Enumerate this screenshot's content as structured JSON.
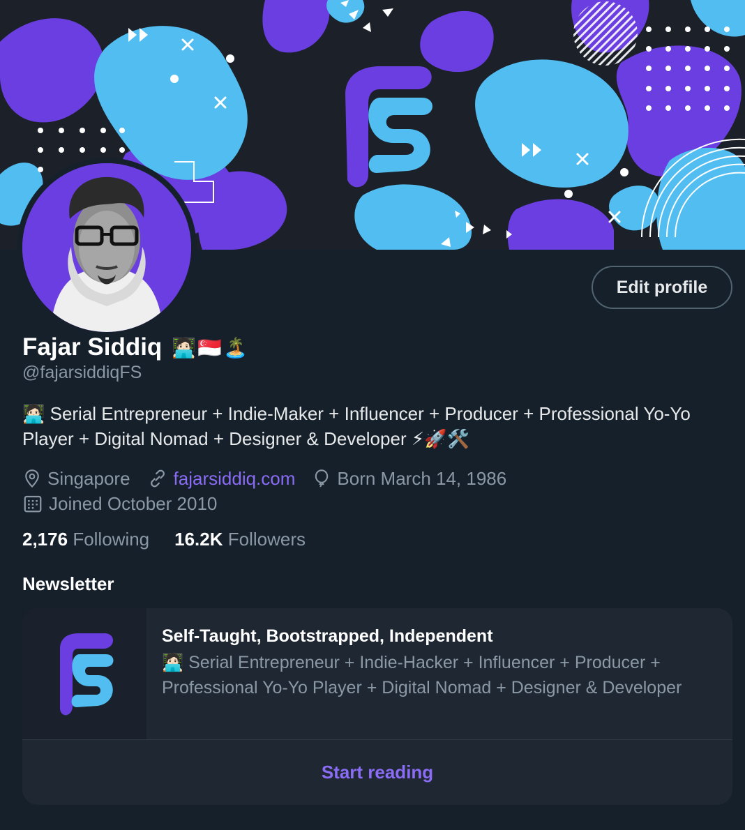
{
  "profile": {
    "name": "Fajar Siddiq",
    "name_emoji": [
      "🧑🏻‍💻",
      "🇸🇬",
      "🏝️"
    ],
    "handle": "@fajarsiddiqFS",
    "bio_line1": "🧑🏻‍💻 Serial Entrepreneur + Indie-Maker + Influencer + Producer + Professional Yo-Yo",
    "bio_line2": "Player + Digital Nomad + Designer & Developer ⚡🚀🛠️",
    "location": "Singapore",
    "website": "fajarsiddiq.com",
    "birthday": "Born March 14, 1986",
    "joined": "Joined October 2010",
    "edit_label": "Edit profile"
  },
  "stats": {
    "following_count": "2,176",
    "following_label": "Following",
    "followers_count": "16.2K",
    "followers_label": "Followers"
  },
  "newsletter": {
    "heading": "Newsletter",
    "title": "Self-Taught, Bootstrapped, Independent",
    "description": "🧑🏻‍💻 Serial Entrepreneur + Indie-Hacker + Influencer + Producer + Professional Yo-Yo Player + Digital Nomad + Designer & Developer",
    "cta": "Start reading"
  },
  "icons": {
    "location": "location-pin-icon",
    "link": "link-icon",
    "birthday": "balloon-icon",
    "joined": "calendar-icon"
  },
  "colors": {
    "background": "#15202b",
    "accent": "#8a6cf5",
    "banner_blue": "#52bdf0",
    "banner_purple": "#6a3ee0",
    "banner_dark": "#1c2129"
  }
}
